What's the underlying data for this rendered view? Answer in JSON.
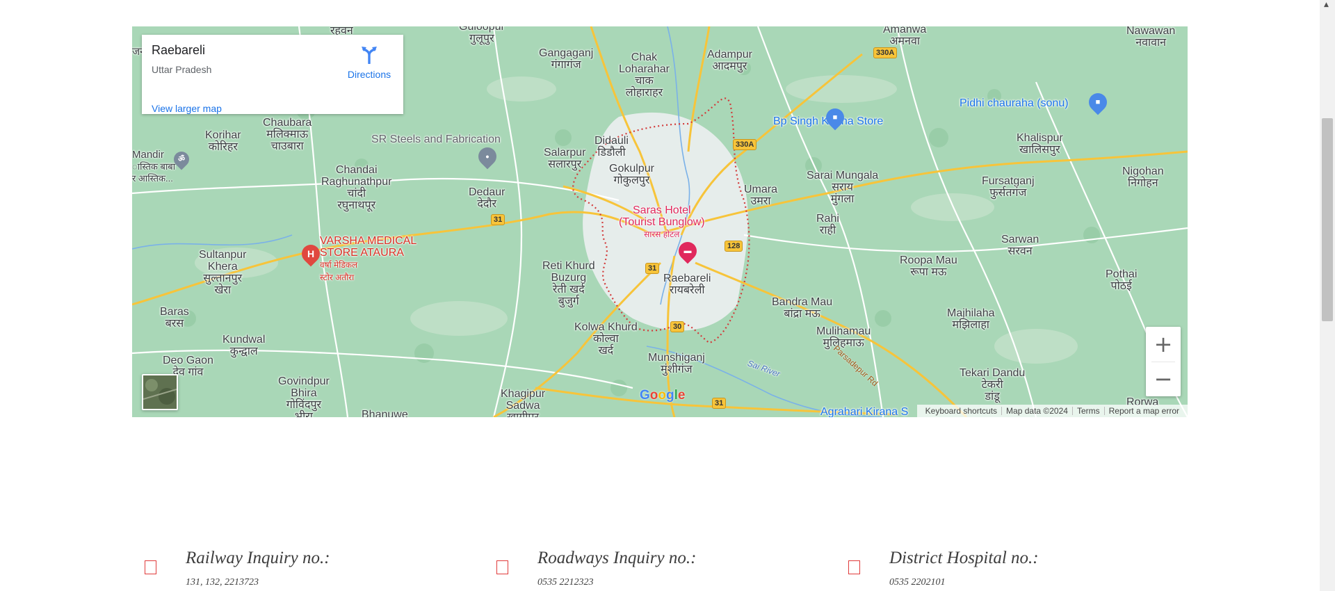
{
  "map": {
    "place_name": "Raebareli",
    "region": "Uttar Pradesh",
    "directions_label": "Directions",
    "view_larger_label": "View larger map",
    "zoom_in": "+",
    "zoom_out": "−",
    "google_logo": [
      "G",
      "o",
      "o",
      "g",
      "l",
      "e"
    ],
    "google_colors": [
      "#4285f4",
      "#ea4335",
      "#fbbc05",
      "#4285f4",
      "#34a853",
      "#ea4335"
    ],
    "attribution": {
      "keyboard": "Keyboard shortcuts",
      "data": "Map data ©2024",
      "terms": "Terms",
      "report": "Report a map error"
    },
    "colors": {
      "water": "#aadaff",
      "land": "#a9d7b7",
      "urban": "#eceff1",
      "road": "#f7c43a",
      "boundary": "#d23a3a"
    },
    "labels": {
      "raebareli": "Raebareli",
      "raebareli_hi": "रायबरेली",
      "raghav": "रहवन",
      "guloopur": "Guloopur",
      "guloopur_hi": "गुलूपुर",
      "ganganj": "Gangaganj",
      "ganganj_hi": "गंगागंज",
      "chak": "Chak",
      "chak2": "Loharahar",
      "chak_hi1": "चाक",
      "chak_hi2": "लोहाराहर",
      "adampur": "Adampur",
      "adampur_hi": "आदमपुर",
      "amanwa": "Amanwa",
      "amanwa_hi": "अमनवा",
      "nawawan": "Nawawan",
      "nawawan_hi": "नवावान",
      "chaubara": "Chaubara",
      "chaubara_hi1": "मलिक्माऊ",
      "chaubara_hi2": "चाउबारा",
      "korihar": "Korihar",
      "korihar_hi": "कोरिहर",
      "mandir": "Mandir",
      "mandir2": "ास्तिक बाबा",
      "mandir3": "र आस्तिक...",
      "chandai": "Chandai",
      "chandai2": "Raghunathpur",
      "chandai_hi1": "चांदी",
      "chandai_hi2": "रघुनाथपूर",
      "sr_steels": "SR Steels and Fabrication",
      "dedaur": "Dedaur",
      "dedaur_hi": "देदौर",
      "salarpur": "Salarpur",
      "salarpur_hi": "सलारपुर",
      "didauli": "Didauli",
      "didauli_hi": "डिडौली",
      "gokulpur": "Gokulpur",
      "gokulpur_hi": "गोकुलपुर",
      "saras1": "Saras Hotel",
      "saras2": "(Tourist Bunglow)",
      "saras_hi": "सारस होटल",
      "bp_singh": "Bp Singh Kirana Store",
      "pidhi": "Pidhi chauraha (sonu)",
      "khalispur": "Khalispur",
      "khalispur_hi": "खालिसपुर",
      "nigohan": "Nigohan",
      "nigohan_hi": "निगोहन",
      "fursatganj": "Fursatganj",
      "fursatganj_hi": "फुर्सतगंज",
      "umara": "Umara",
      "umara_hi": "उमरा",
      "sarai": "Sarai Mungala",
      "sarai_hi1": "सराय",
      "sarai_hi2": "मुंगला",
      "rahi": "Rahi",
      "rahi_hi": "राही",
      "sarwan": "Sarwan",
      "sarwan_hi": "सरवन",
      "roopa": "Roopa Mau",
      "roopa_hi": "रूपा मऊ",
      "pothai": "Pothai",
      "pothai_hi": "पोठई",
      "varsha1": "VARSHA MEDICAL",
      "varsha2": "STORE ATAURA",
      "varsha_hi1": "वर्षा मेडिकल",
      "varsha_hi2": "स्टोर अतौरा",
      "sultanpur": "Sultanpur",
      "sultanpur2": "Khera",
      "sultanpur_hi1": "सुल्तानपुर",
      "sultanpur_hi2": "खेरा",
      "reti": "Reti Khurd",
      "reti2": "Buzurg",
      "reti_hi1": "रेती खर्द",
      "reti_hi2": "बुजुर्ग",
      "baras": "Baras",
      "baras_hi": "बरस",
      "kundwal": "Kundwal",
      "kundwal_hi": "कुन्द्वाल",
      "deogaon": "Deo Gaon",
      "deogaon_hi": "देव गांव",
      "kolwa": "Kolwa Khurd",
      "kolwa_hi1": "कोल्वा",
      "kolwa_hi2": "खर्द",
      "bandra": "Bandra Mau",
      "bandra_hi": "बांद्रा मऊ",
      "mulihamau": "Mulihamau",
      "mulihamau_hi": "मुलिहमाऊ",
      "majhilaha": "Majhilaha",
      "majhilaha_hi": "मझिलाहा",
      "munshiganj": "Munshiganj",
      "munshiganj_hi": "मुंशीगंज",
      "sai_river": "Sai River",
      "parsadepur": "Parsadepur Rd",
      "govindpur": "Govindpur",
      "govindpur2": "Bhira",
      "govindpur_hi1": "गोविंदपुर",
      "govindpur_hi2": "भीरा",
      "khagipur": "Khagipur",
      "khagipur2": "Sadwa",
      "khagipur_hi": "खागीपुर",
      "bhanuwe": "Bhanuwe",
      "tekari": "Tekari Dandu",
      "tekari_hi1": "टेकरी",
      "tekari_hi2": "डांडू",
      "rorwa": "Rorwa",
      "agrahari": "Agrahari Kirana S",
      "jan": "जन"
    },
    "shields": {
      "s330a_1": "330A",
      "s330a_2": "330A",
      "s31_1": "31",
      "s31_2": "31",
      "s31_3": "31",
      "s128": "128",
      "s30": "30"
    }
  },
  "contacts": [
    {
      "title": "Railway Inquiry no.:",
      "value": "131, 132, 2213723"
    },
    {
      "title": "Roadways Inquiry no.:",
      "value": "0535 2212323"
    },
    {
      "title": "District Hospital no.:",
      "value": "0535 2202101"
    }
  ],
  "scrollbar": {
    "up_arrow": "▲"
  }
}
